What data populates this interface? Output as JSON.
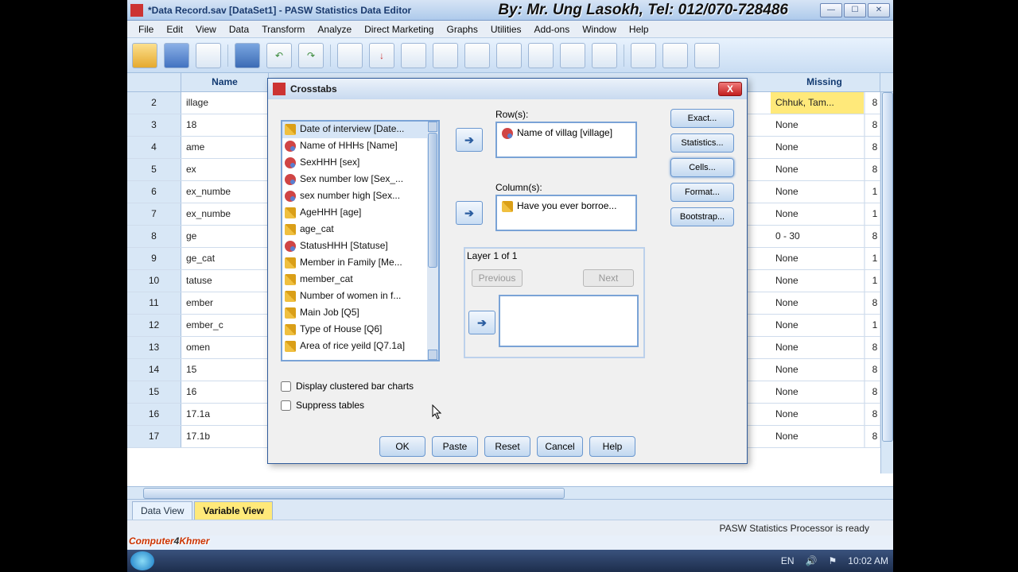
{
  "title": "*Data Record.sav [DataSet1] - PASW Statistics Data Editor",
  "author": "By: Mr. Ung Lasokh, Tel: 012/070-728486",
  "menu": [
    "File",
    "Edit",
    "View",
    "Data",
    "Transform",
    "Analyze",
    "Direct Marketing",
    "Graphs",
    "Utilities",
    "Add-ons",
    "Window",
    "Help"
  ],
  "columns": {
    "name": "Name",
    "missing": "Missing"
  },
  "rows": [
    {
      "n": "2",
      "name": "illage",
      "miss": "Chhuk, Tam...",
      "x": "8",
      "hl": true
    },
    {
      "n": "3",
      "name": "18",
      "miss": "None",
      "x": "8"
    },
    {
      "n": "4",
      "name": "ame",
      "miss": "None",
      "x": "8"
    },
    {
      "n": "5",
      "name": "ex",
      "miss": "None",
      "x": "8"
    },
    {
      "n": "6",
      "name": "ex_numbe",
      "miss": "None",
      "x": "1"
    },
    {
      "n": "7",
      "name": "ex_numbe",
      "miss": "None",
      "x": "1"
    },
    {
      "n": "8",
      "name": "ge",
      "miss": "0 - 30",
      "x": "8"
    },
    {
      "n": "9",
      "name": "ge_cat",
      "miss": "None",
      "x": "1"
    },
    {
      "n": "10",
      "name": "tatuse",
      "miss": "None",
      "x": "1"
    },
    {
      "n": "11",
      "name": "ember",
      "miss": "None",
      "x": "8"
    },
    {
      "n": "12",
      "name": "ember_c",
      "miss": "None",
      "x": "1"
    },
    {
      "n": "13",
      "name": "omen",
      "miss": "None",
      "x": "8"
    },
    {
      "n": "14",
      "name": "15",
      "miss": "None",
      "x": "8"
    },
    {
      "n": "15",
      "name": "16",
      "miss": "None",
      "x": "8"
    },
    {
      "n": "16",
      "name": "17.1a",
      "miss": "None",
      "x": "8"
    },
    {
      "n": "17",
      "name": "17.1b",
      "miss": "None",
      "x": "8"
    }
  ],
  "tabs": {
    "data": "Data View",
    "variable": "Variable View"
  },
  "status": "PASW Statistics Processor is ready",
  "dialog": {
    "title": "Crosstabs",
    "vars": [
      {
        "t": "ruler",
        "l": "Date of interview [Date...",
        "sel": true
      },
      {
        "t": "nom",
        "l": "Name of HHHs [Name]"
      },
      {
        "t": "nom",
        "l": "SexHHH [sex]"
      },
      {
        "t": "nom",
        "l": "Sex number low [Sex_..."
      },
      {
        "t": "nom",
        "l": "sex number high [Sex..."
      },
      {
        "t": "ruler",
        "l": "AgeHHH [age]"
      },
      {
        "t": "ruler",
        "l": "age_cat"
      },
      {
        "t": "nom",
        "l": "StatusHHH [Statuse]"
      },
      {
        "t": "ruler",
        "l": "Member in Family [Me..."
      },
      {
        "t": "ruler",
        "l": "member_cat"
      },
      {
        "t": "ruler",
        "l": "Number of women in f..."
      },
      {
        "t": "ruler",
        "l": "Main Job [Q5]"
      },
      {
        "t": "ruler",
        "l": "Type of House [Q6]"
      },
      {
        "t": "ruler",
        "l": "Area of rice yeild [Q7.1a]"
      }
    ],
    "rows_label": "Row(s):",
    "rows_item": "Name of villag [village]",
    "cols_label": "Column(s):",
    "cols_item": "Have you ever borroe...",
    "layer_label": "Layer 1 of 1",
    "prev": "Previous",
    "next": "Next",
    "side": [
      "Exact...",
      "Statistics...",
      "Cells...",
      "Format...",
      "Bootstrap..."
    ],
    "chk1": "Display clustered bar charts",
    "chk2": "Suppress tables",
    "btns": [
      "OK",
      "Paste",
      "Reset",
      "Cancel",
      "Help"
    ]
  },
  "taskbar": {
    "lang": "EN",
    "time": "10:02 AM"
  },
  "watermark1": "Computer",
  "watermark2": "4",
  "watermark3": "Khmer"
}
